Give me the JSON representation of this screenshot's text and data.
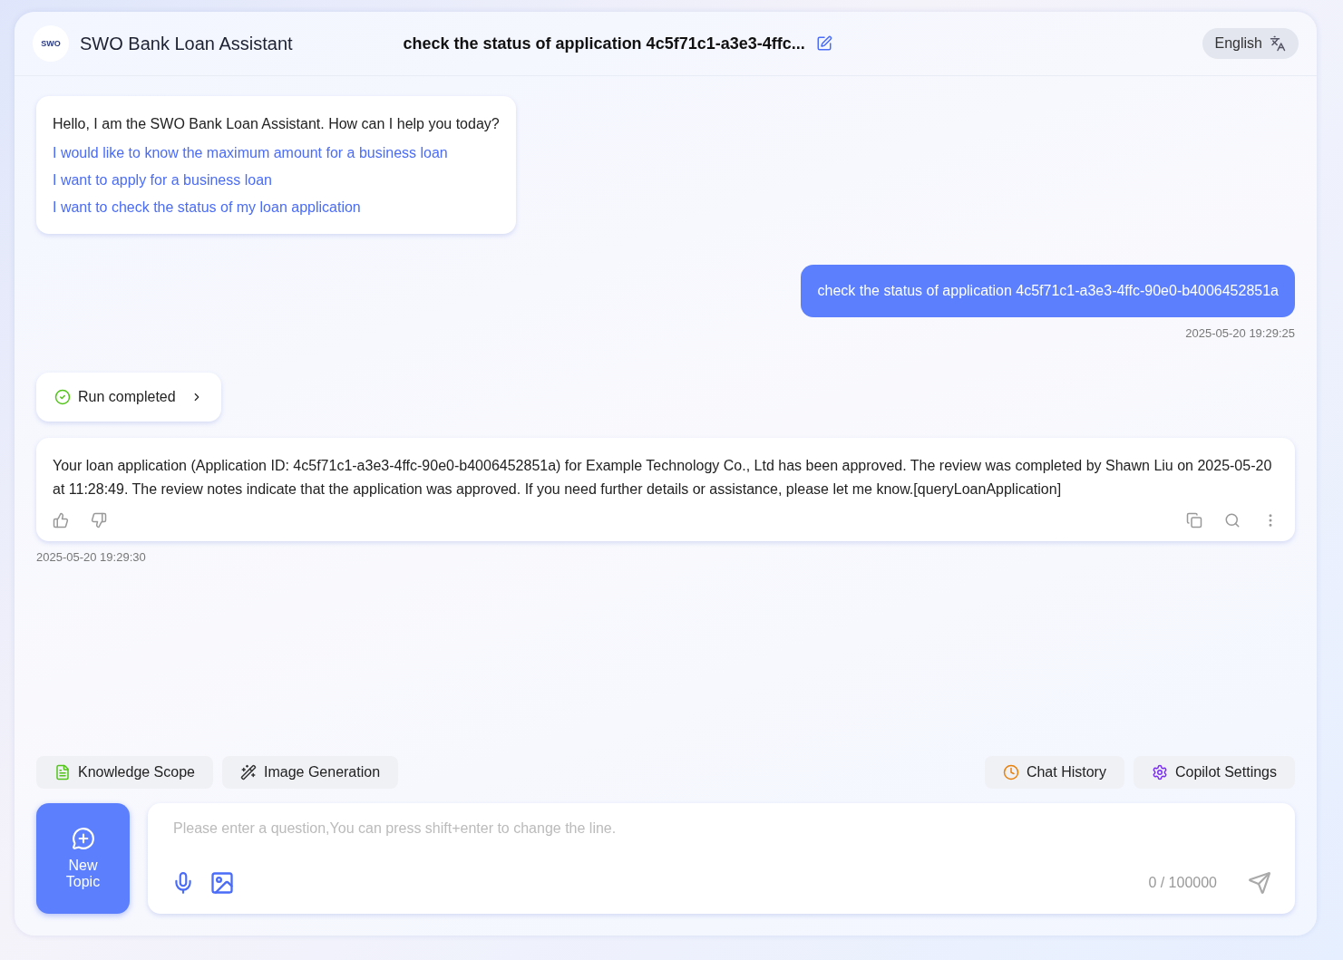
{
  "header": {
    "logo": "SWO",
    "title": "SWO Bank Loan Assistant",
    "conversation_title": "check the status of application 4c5f71c1-a3e3-4ffc...",
    "language": "English"
  },
  "messages": [
    {
      "kind": "welcome",
      "text": "Hello, I am the SWO Bank Loan Assistant. How can I help you today?",
      "suggestions": [
        "I would like to know the maximum amount for a business loan",
        "I want to apply for a business loan",
        "I want to check the status of my loan application"
      ]
    },
    {
      "kind": "user",
      "text": "check the status of application 4c5f71c1-a3e3-4ffc-90e0-b4006452851a",
      "time": "2025-05-20 19:29:25"
    },
    {
      "kind": "run",
      "text": "Run completed"
    },
    {
      "kind": "answer",
      "text": "Your loan application (Application ID: 4c5f71c1-a3e3-4ffc-90e0-b4006452851a) for Example Technology Co., Ltd has been approved. The review was completed by Shawn Liu on 2025-05-20 at 11:28:49. The review notes indicate that the application was approved. If you need further details or assistance, please let me know.[queryLoanApplication]",
      "time": "2025-05-20 19:29:30"
    }
  ],
  "tools_left": [
    {
      "label": "Knowledge Scope",
      "kind": "doc",
      "color": "#52c41a"
    },
    {
      "label": "Image Generation",
      "kind": "wand",
      "color": "#333333"
    }
  ],
  "tools_right": [
    {
      "label": "Chat History",
      "kind": "clock",
      "color": "#e8800c"
    },
    {
      "label": "Copilot Settings",
      "kind": "gear",
      "color": "#7a2ff0"
    }
  ],
  "new_topic": "New Topic",
  "input": {
    "placeholder": "Please enter a question,You can press shift+enter to change the line.",
    "counter": "0 / 100000"
  }
}
